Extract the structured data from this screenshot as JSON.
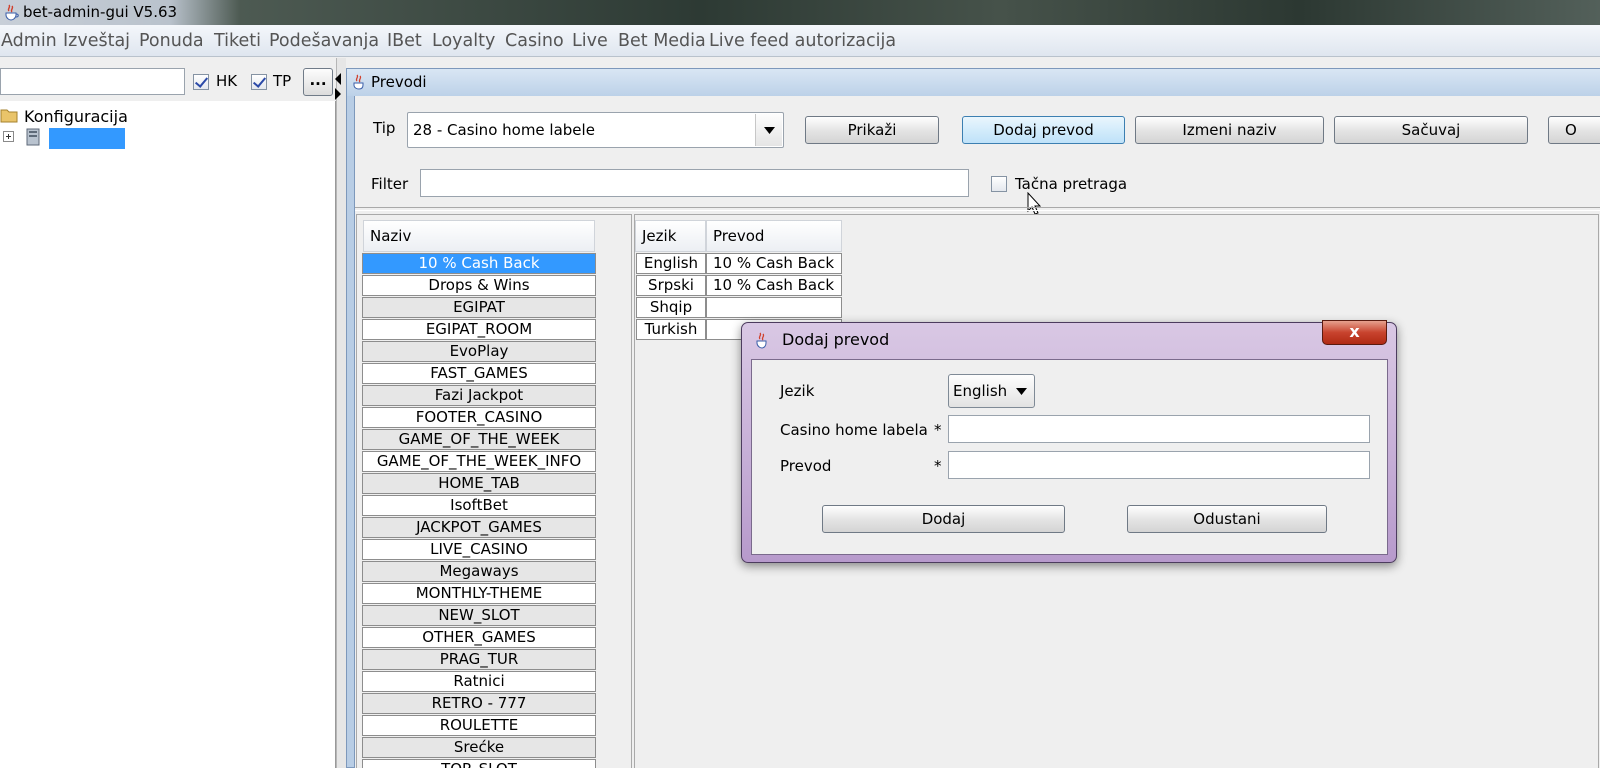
{
  "window": {
    "title": "bet-admin-gui V5.63"
  },
  "menu": [
    "Admin",
    "Izveštaj",
    "Ponuda",
    "Tiketi",
    "Podešavanja",
    "IBet",
    "Loyalty",
    "Casino",
    "Live",
    "Bet Media",
    "Live feed autorizacija"
  ],
  "left": {
    "search_value": "",
    "hk_label": "HK",
    "hk_checked": true,
    "tp_label": "TP",
    "tp_checked": true,
    "more_label": "...",
    "tree_root": "Konfiguracija"
  },
  "frame": {
    "title": "Prevodi",
    "tip_label": "Tip",
    "tip_value": "28 - Casino home labele",
    "buttons": {
      "prikazi": "Prikaži",
      "dodaj": "Dodaj prevod",
      "izmeni": "Izmeni naziv",
      "sacuvaj": "Sačuvaj",
      "extra": "O"
    },
    "filter_label": "Filter",
    "filter_value": "",
    "exact_label": "Tačna pretraga",
    "exact_checked": false
  },
  "naziv": {
    "header": "Naziv",
    "rows": [
      "10 % Cash Back",
      "Drops & Wins",
      "EGIPAT",
      "EGIPAT_ROOM",
      "EvoPlay",
      "FAST_GAMES",
      "Fazi Jackpot",
      "FOOTER_CASINO",
      "GAME_OF_THE_WEEK",
      "GAME_OF_THE_WEEK_INFO",
      "HOME_TAB",
      "IsoftBet",
      "JACKPOT_GAMES",
      "LIVE_CASINO",
      "Megaways",
      "MONTHLY-THEME",
      "NEW_SLOT",
      "OTHER_GAMES",
      "PRAG_TUR",
      "Ratnici",
      "RETRO - 777",
      "ROULETTE",
      "Srećke",
      "TOP_SLOT"
    ],
    "selected": 0
  },
  "translations": {
    "headers": [
      "Jezik",
      "Prevod"
    ],
    "rows": [
      {
        "jezik": "English",
        "prevod": "10 % Cash Back"
      },
      {
        "jezik": "Srpski",
        "prevod": "10 % Cash Back"
      },
      {
        "jezik": "Shqip",
        "prevod": ""
      },
      {
        "jezik": "Turkish",
        "prevod": ""
      }
    ]
  },
  "dialog": {
    "title": "Dodaj prevod",
    "close": "x",
    "jezik_label": "Jezik",
    "jezik_value": "English",
    "labela_label": "Casino home labela",
    "prevod_label": "Prevod",
    "required": "*",
    "labela_value": "",
    "prevod_value": "",
    "ok": "Dodaj",
    "cancel": "Odustani"
  },
  "colors": {
    "selection": "#3399ff",
    "frame_header": "#bcd1e8",
    "dialog_border": "#b79acc"
  }
}
